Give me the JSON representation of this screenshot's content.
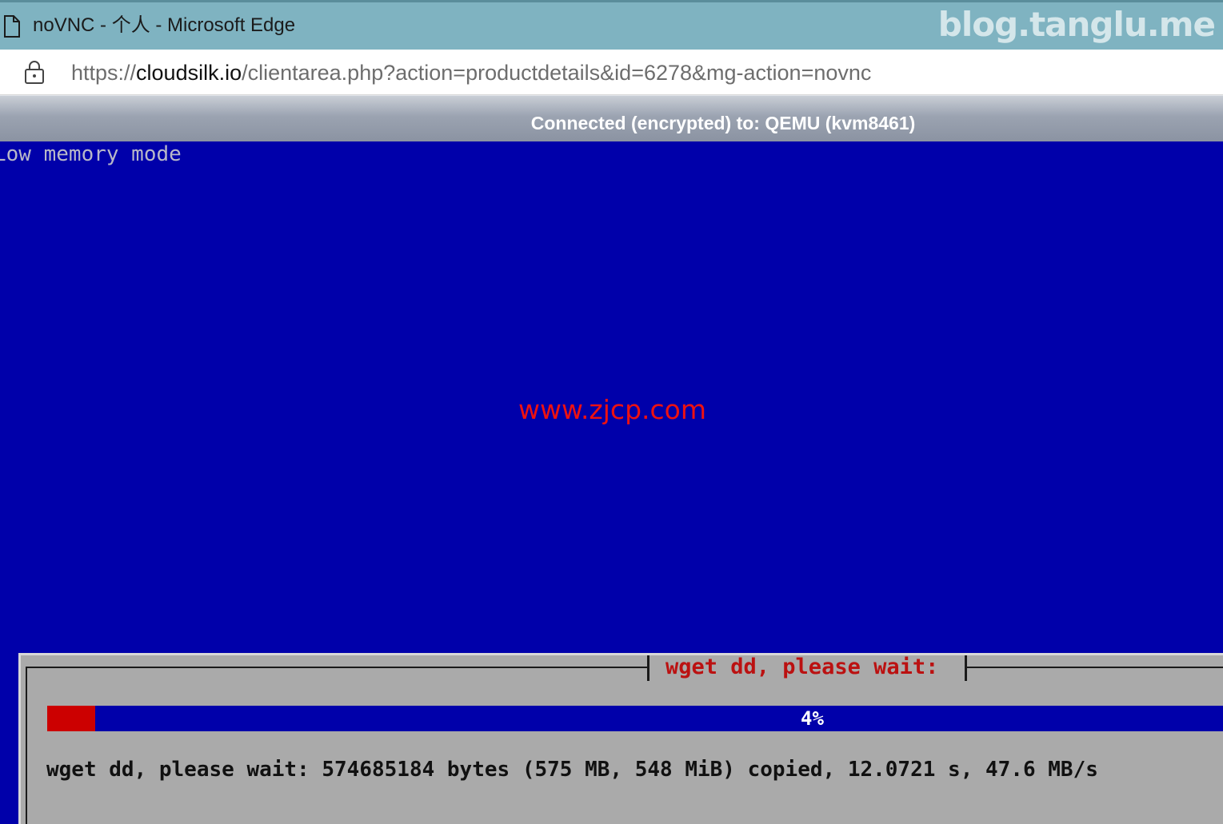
{
  "window": {
    "title": "noVNC - 个人 - Microsoft Edge",
    "watermark": "blog.tanglu.me"
  },
  "address_bar": {
    "url_prefix": "https://",
    "url_domain": "cloudsilk.io",
    "url_path": "/clientarea.php?action=productdetails&id=6278&mg-action=novnc"
  },
  "vnc": {
    "status": "Connected (encrypted) to: QEMU (kvm8461)",
    "console_text": "Low memory mode",
    "center_watermark": "www.zjcp.com"
  },
  "dialog": {
    "title": "wget dd, please wait:",
    "progress_percent": 4,
    "progress_label": "4%",
    "message": "wget dd, please wait: 574685184 bytes (575 MB, 548 MiB) copied, 12.0721 s, 47.6 MB/s"
  },
  "colors": {
    "titlebar": "#7fb3c1",
    "console_background": "#0000aa",
    "progress_fill": "#cc0000",
    "dialog_background": "#aaaaaa",
    "dialog_title": "#bb1111"
  }
}
